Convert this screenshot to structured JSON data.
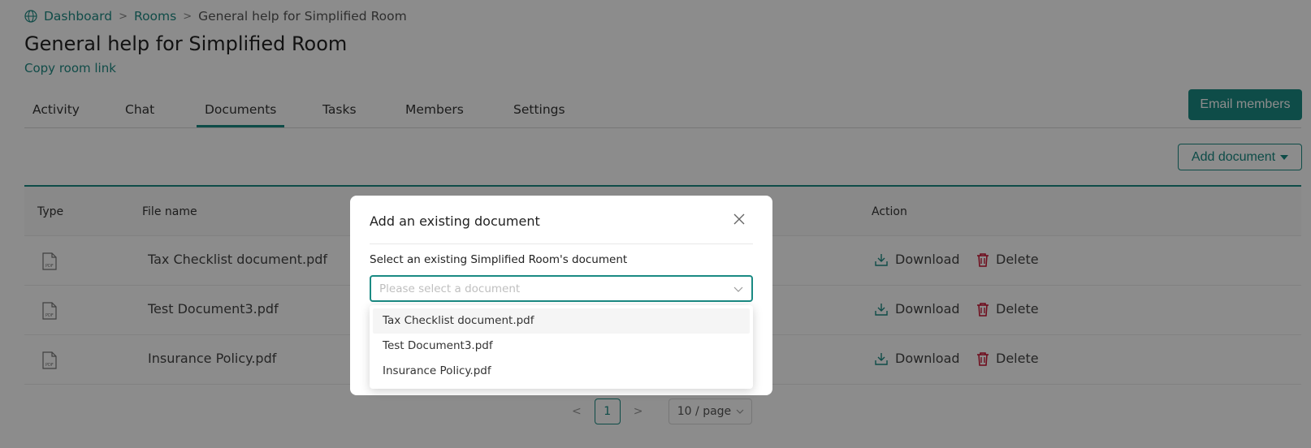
{
  "breadcrumb": {
    "items": [
      "Dashboard",
      "Rooms",
      "General help for Simplified Room"
    ],
    "separator": ">"
  },
  "page": {
    "title": "General help for Simplified Room",
    "copy_link": "Copy room link"
  },
  "tabs": [
    {
      "label": "Activity",
      "active": false
    },
    {
      "label": "Chat",
      "active": false
    },
    {
      "label": "Documents",
      "active": true
    },
    {
      "label": "Tasks",
      "active": false
    },
    {
      "label": "Members",
      "active": false
    },
    {
      "label": "Settings",
      "active": false
    }
  ],
  "actions": {
    "email_members": "Email members",
    "add_document": "Add document"
  },
  "table": {
    "columns": [
      "Type",
      "File name",
      "Action"
    ],
    "rows": [
      {
        "type_icon": "pdf-file-icon",
        "file_name": "Tax Checklist document.pdf",
        "download": "Download",
        "delete": "Delete"
      },
      {
        "type_icon": "pdf-file-icon",
        "file_name": "Test Document3.pdf",
        "download": "Download",
        "delete": "Delete"
      },
      {
        "type_icon": "pdf-file-icon",
        "file_name": "Insurance Policy.pdf",
        "download": "Download",
        "delete": "Delete"
      }
    ]
  },
  "pagination": {
    "prev": "<",
    "current_page": "1",
    "next": ">",
    "page_size": "10 / page"
  },
  "modal": {
    "title": "Add an existing document",
    "field_label": "Select an existing Simplified Room's document",
    "placeholder": "Please select a document",
    "options": [
      "Tax Checklist document.pdf",
      "Test Document3.pdf",
      "Insurance Policy.pdf"
    ]
  },
  "colors": {
    "accent": "#1a8a83",
    "danger": "#c8102e",
    "overlay": "rgba(0,0,0,0.45)"
  }
}
